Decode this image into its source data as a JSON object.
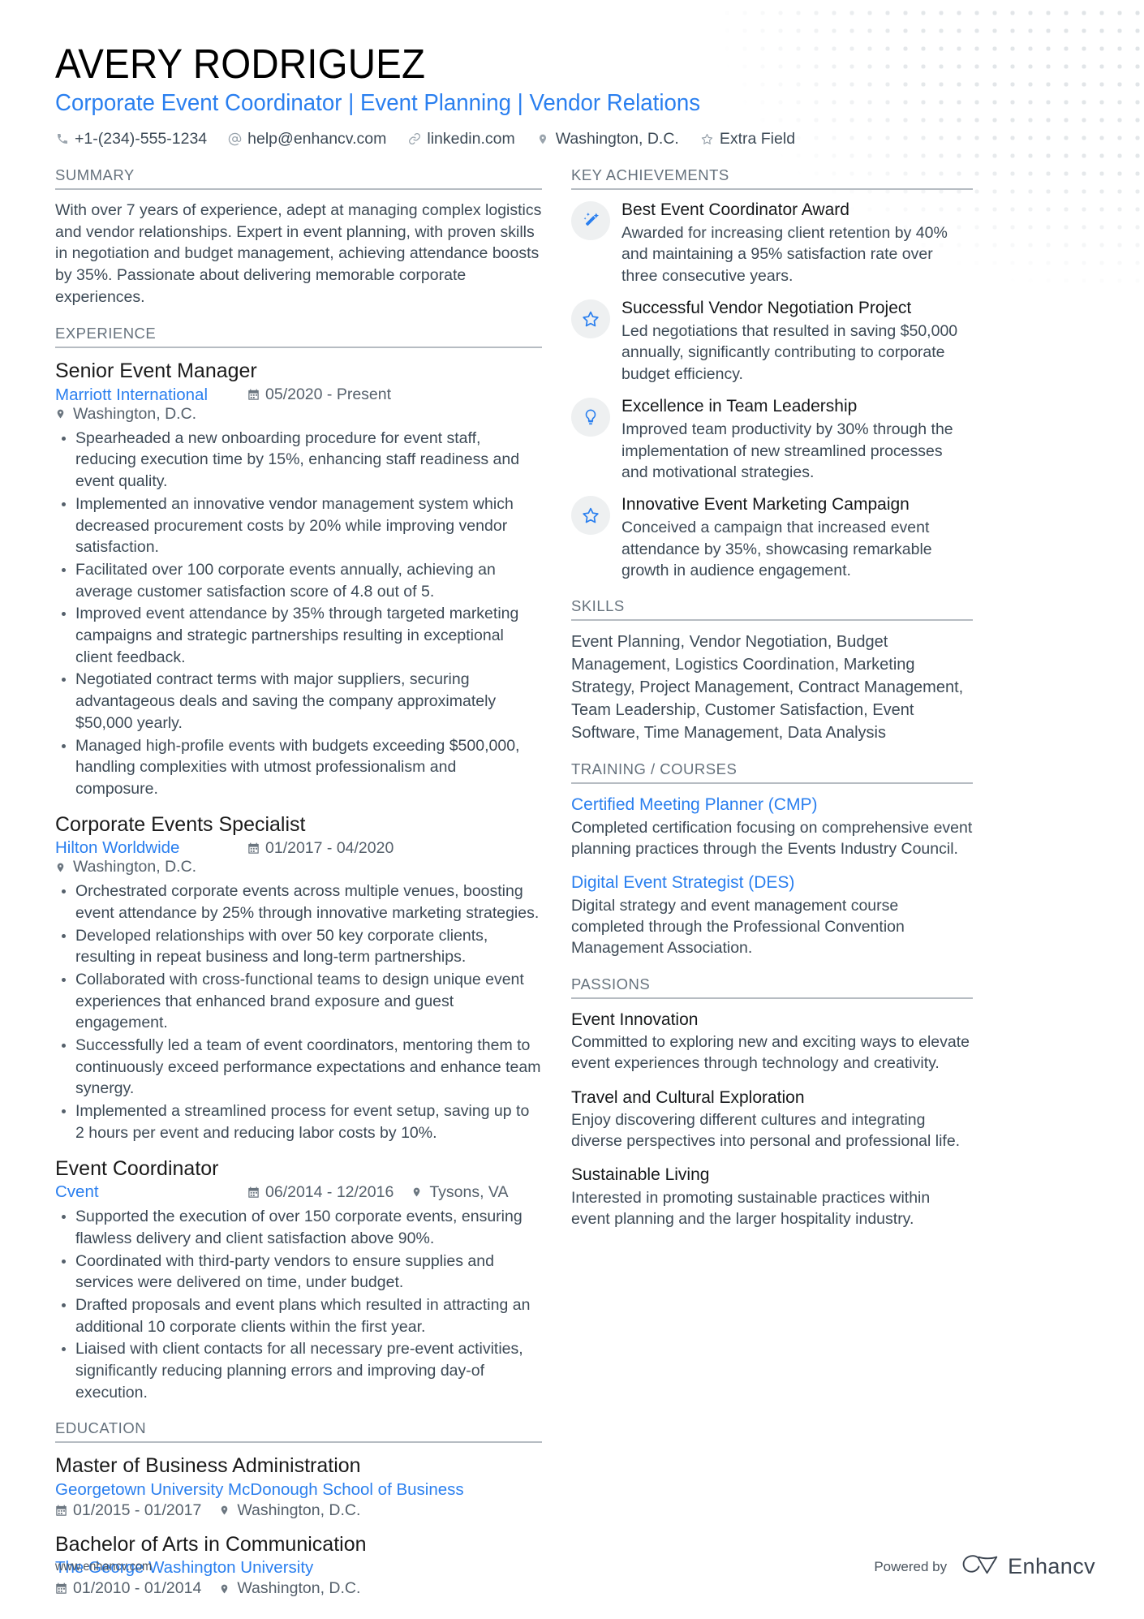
{
  "colors": {
    "accent": "#2a7fef",
    "rule": "#b6bcc2",
    "body_text": "#3d4a56",
    "muted": "#66727d"
  },
  "header": {
    "name": "AVERY RODRIGUEZ",
    "headline": "Corporate Event Coordinator | Event Planning | Vendor Relations",
    "contacts": [
      {
        "icon": "phone-icon",
        "text": "+1-(234)-555-1234"
      },
      {
        "icon": "at-sign-icon",
        "text": "help@enhancv.com"
      },
      {
        "icon": "link-icon",
        "text": "linkedin.com"
      },
      {
        "icon": "map-pin-icon",
        "text": "Washington, D.C."
      },
      {
        "icon": "star-icon",
        "text": "Extra Field"
      }
    ]
  },
  "summary": {
    "title": "SUMMARY",
    "text": "With over 7 years of experience, adept at managing complex logistics and vendor relationships. Expert in event planning, with proven skills in negotiation and budget management, achieving attendance boosts by 35%. Passionate about delivering memorable corporate experiences."
  },
  "experience": {
    "title": "EXPERIENCE",
    "entries": [
      {
        "role": "Senior Event Manager",
        "company": "Marriott International",
        "dates": "05/2020 - Present",
        "location": "Washington, D.C.",
        "bullets": [
          "Spearheaded a new onboarding procedure for event staff, reducing execution time by 15%, enhancing staff readiness and event quality.",
          "Implemented an innovative vendor management system which decreased procurement costs by 20% while improving vendor satisfaction.",
          "Facilitated over 100 corporate events annually, achieving an average customer satisfaction score of 4.8 out of 5.",
          "Improved event attendance by 35% through targeted marketing campaigns and strategic partnerships resulting in exceptional client feedback.",
          "Negotiated contract terms with major suppliers, securing advantageous deals and saving the company approximately $50,000 yearly.",
          "Managed high-profile events with budgets exceeding $500,000, handling complexities with utmost professionalism and composure."
        ]
      },
      {
        "role": "Corporate Events Specialist",
        "company": "Hilton Worldwide",
        "dates": "01/2017 - 04/2020",
        "location": "Washington, D.C.",
        "bullets": [
          "Orchestrated corporate events across multiple venues, boosting event attendance by 25% through innovative marketing strategies.",
          "Developed relationships with over 50 key corporate clients, resulting in repeat business and long-term partnerships.",
          "Collaborated with cross-functional teams to design unique event experiences that enhanced brand exposure and guest engagement.",
          "Successfully led a team of event coordinators, mentoring them to continuously exceed performance expectations and enhance team synergy.",
          "Implemented a streamlined process for event setup, saving up to 2 hours per event and reducing labor costs by 10%."
        ]
      },
      {
        "role": "Event Coordinator",
        "company": "Cvent",
        "dates": "06/2014 - 12/2016",
        "location": "Tysons, VA",
        "bullets": [
          "Supported the execution of over 150 corporate events, ensuring flawless delivery and client satisfaction above 90%.",
          "Coordinated with third-party vendors to ensure supplies and services were delivered on time, under budget.",
          "Drafted proposals and event plans which resulted in attracting an additional 10 corporate clients within the first year.",
          "Liaised with client contacts for all necessary pre-event activities, significantly reducing planning errors and improving day-of execution."
        ]
      }
    ]
  },
  "education": {
    "title": "EDUCATION",
    "entries": [
      {
        "degree": "Master of Business Administration",
        "school": "Georgetown University McDonough School of Business",
        "dates": "01/2015 - 01/2017",
        "location": "Washington, D.C."
      },
      {
        "degree": "Bachelor of Arts in Communication",
        "school": "The George Washington University",
        "dates": "01/2010 - 01/2014",
        "location": "Washington, D.C."
      }
    ]
  },
  "key_achievements": {
    "title": "KEY ACHIEVEMENTS",
    "items": [
      {
        "icon": "magic-wand-icon",
        "title": "Best Event Coordinator Award",
        "desc": "Awarded for increasing client retention by 40% and maintaining a 95% satisfaction rate over three consecutive years."
      },
      {
        "icon": "star-outline-icon",
        "title": "Successful Vendor Negotiation Project",
        "desc": "Led negotiations that resulted in saving $50,000 annually, significantly contributing to corporate budget efficiency."
      },
      {
        "icon": "lightbulb-icon",
        "title": "Excellence in Team Leadership",
        "desc": "Improved team productivity by 30% through the implementation of new streamlined processes and motivational strategies."
      },
      {
        "icon": "star-outline-icon",
        "title": "Innovative Event Marketing Campaign",
        "desc": "Conceived a campaign that increased event attendance by 35%, showcasing remarkable growth in audience engagement."
      }
    ]
  },
  "skills": {
    "title": "SKILLS",
    "text": "Event Planning, Vendor Negotiation, Budget Management, Logistics Coordination, Marketing Strategy, Project Management, Contract Management, Team Leadership, Customer Satisfaction, Event Software, Time Management, Data Analysis"
  },
  "training": {
    "title": "TRAINING / COURSES",
    "items": [
      {
        "name": "Certified Meeting Planner (CMP)",
        "desc": "Completed certification focusing on comprehensive event planning practices through the Events Industry Council."
      },
      {
        "name": "Digital Event Strategist (DES)",
        "desc": "Digital strategy and event management course completed through the Professional Convention Management Association."
      }
    ]
  },
  "passions": {
    "title": "PASSIONS",
    "items": [
      {
        "name": "Event Innovation",
        "desc": "Committed to exploring new and exciting ways to elevate event experiences through technology and creativity."
      },
      {
        "name": "Travel and Cultural Exploration",
        "desc": "Enjoy discovering different cultures and integrating diverse perspectives into personal and professional life."
      },
      {
        "name": "Sustainable Living",
        "desc": "Interested in promoting sustainable practices within event planning and the larger hospitality industry."
      }
    ]
  },
  "footer": {
    "url": "www.enhancv.com",
    "powered_by": "Powered by",
    "brand": "Enhancv"
  }
}
